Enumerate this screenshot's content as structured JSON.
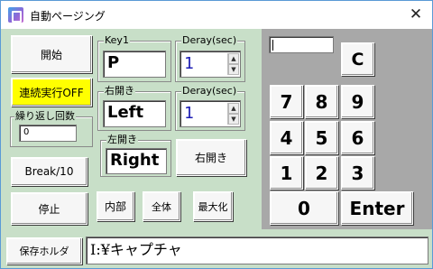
{
  "window": {
    "title": "自動ページング",
    "close_glyph": "✕"
  },
  "buttons": {
    "start": "開始",
    "continuous_off": "連続実行OFF",
    "break": "Break/10",
    "stop": "停止",
    "internal": "内部",
    "whole": "全体",
    "maximize": "最大化",
    "right_open": "右開き",
    "save_folder": "保存ホルダ"
  },
  "groups": {
    "repeat_count": {
      "label": "繰り返し回数",
      "value": "0"
    },
    "key1": {
      "label": "Key1",
      "value": "P"
    },
    "delay1": {
      "label": "Deray(sec)",
      "value": "1"
    },
    "right_open_key": {
      "label": "右開き",
      "value": "Left"
    },
    "delay2": {
      "label": "Deray(sec)",
      "value": "1"
    },
    "left_open_key": {
      "label": "左開き",
      "value": "Right"
    }
  },
  "numpad": {
    "display": "",
    "clear": "C",
    "keys": [
      "7",
      "8",
      "9",
      "4",
      "5",
      "6",
      "1",
      "2",
      "3"
    ],
    "zero": "0",
    "enter": "Enter"
  },
  "save_path": "I:¥キャプチャ",
  "colors": {
    "form_background": "#c8dfc8",
    "numpad_background": "#a8a8a8",
    "highlight_button": "#ffff00",
    "spin_value": "#1c1cb4"
  },
  "icons": {
    "app": "app-icon",
    "close": "close-icon",
    "spin_up": "spin-up-arrow-icon",
    "spin_down": "spin-down-arrow-icon"
  }
}
